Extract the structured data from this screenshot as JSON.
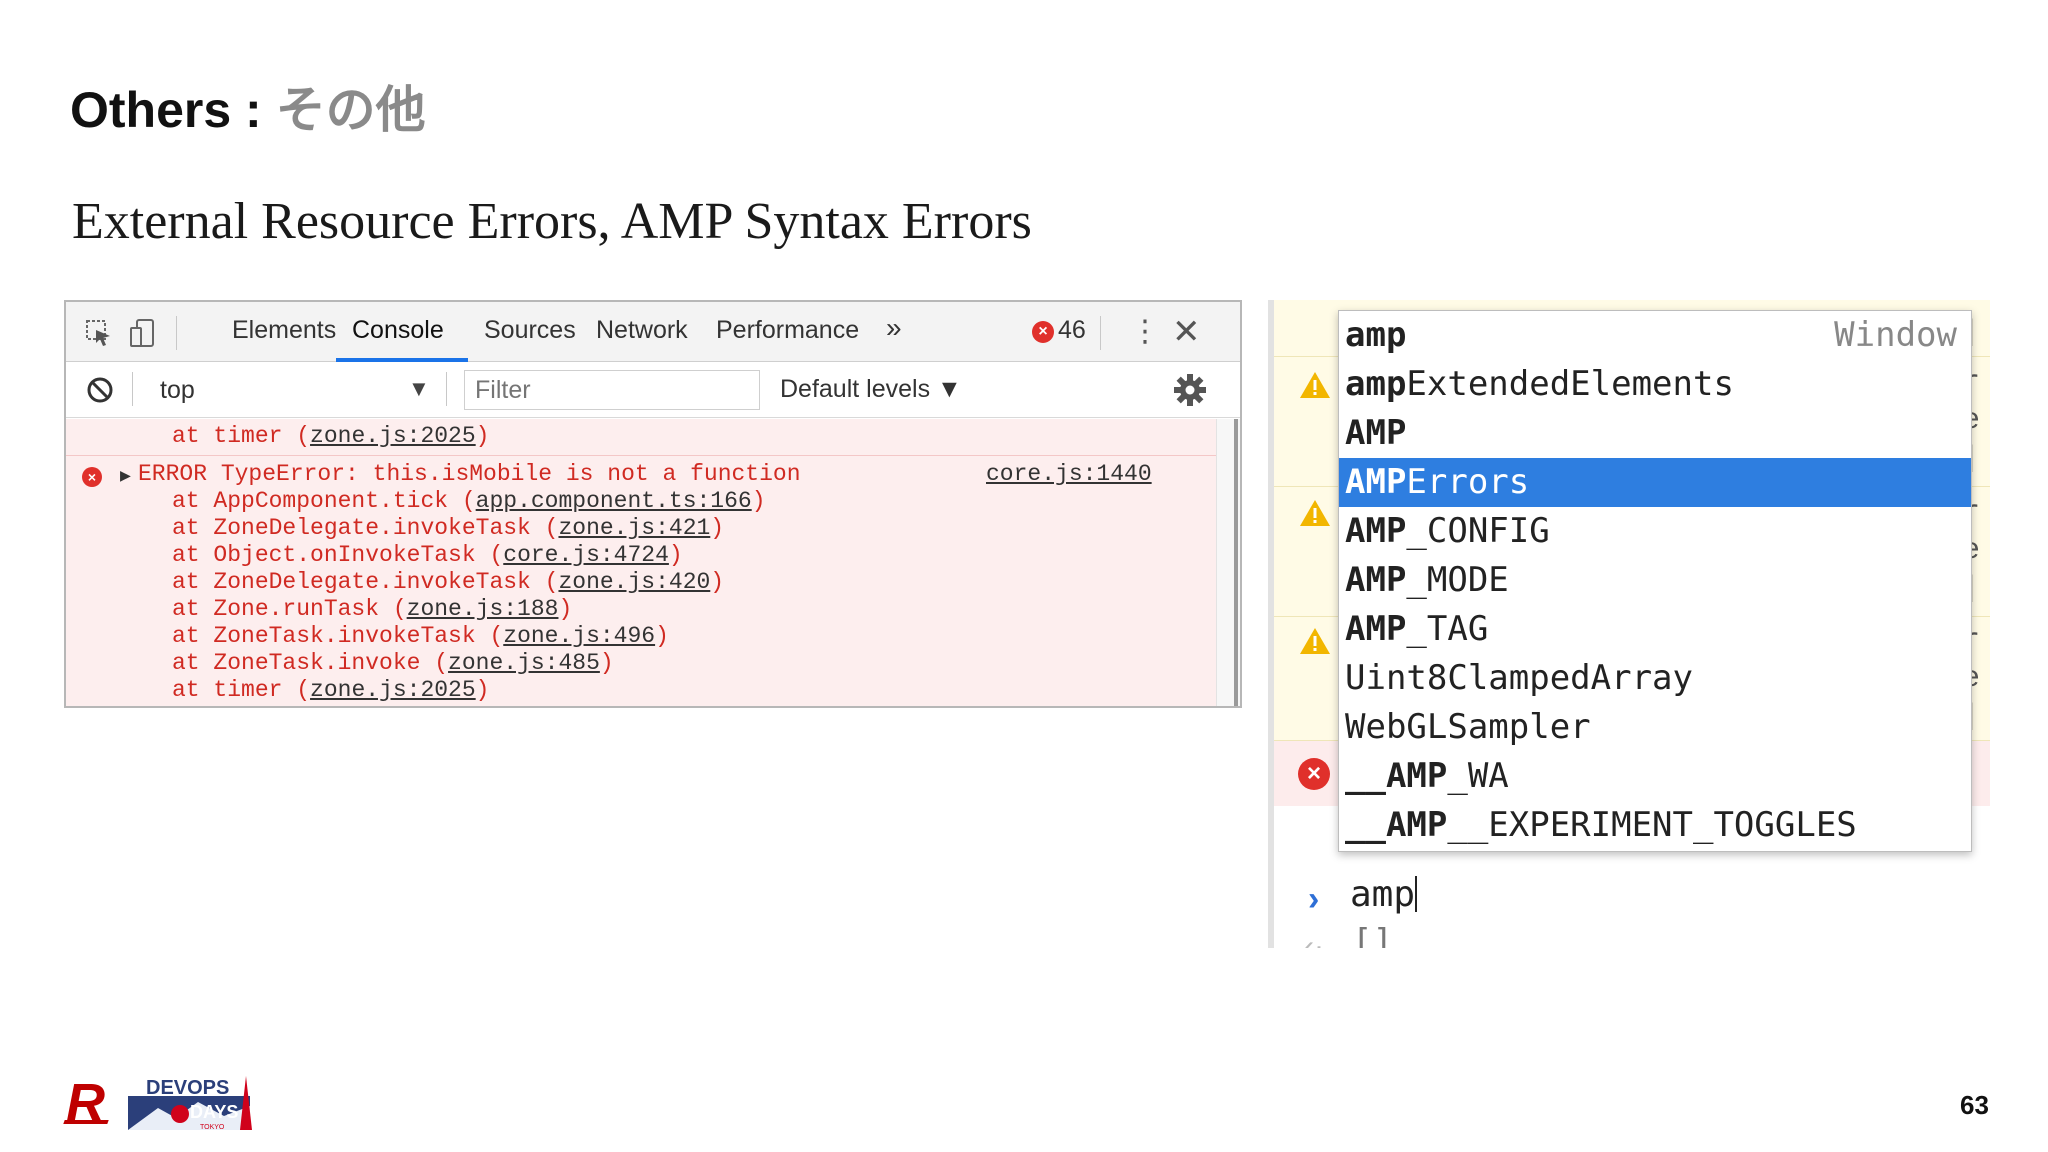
{
  "slide": {
    "title_prefix": "Others : ",
    "title_jp": "その他",
    "subtitle": "External Resource Errors, AMP Syntax Errors",
    "page_number": "63"
  },
  "devtools": {
    "tabs": [
      "Elements",
      "Console",
      "Sources",
      "Network",
      "Performance"
    ],
    "active_tab": "Console",
    "more_tabs": "»",
    "error_count": "46",
    "context": "top",
    "filter_placeholder": "Filter",
    "levels": "Default levels ▼",
    "console_lines": {
      "first_at": "at timer (",
      "first_link": "zone.js:2025",
      "error_text": "ERROR TypeError: this.isMobile is not a function",
      "error_source": "core.js:1440",
      "stack": [
        {
          "pre": "at AppComponent.tick (",
          "link": "app.component.ts:166"
        },
        {
          "pre": "at ZoneDelegate.invokeTask (",
          "link": "zone.js:421"
        },
        {
          "pre": "at Object.onInvokeTask (",
          "link": "core.js:4724"
        },
        {
          "pre": "at ZoneDelegate.invokeTask (",
          "link": "zone.js:420"
        },
        {
          "pre": "at Zone.runTask (",
          "link": "zone.js:188"
        },
        {
          "pre": "at ZoneTask.invokeTask (",
          "link": "zone.js:496"
        },
        {
          "pre": "at ZoneTask.invoke (",
          "link": "zone.js:485"
        },
        {
          "pre": "at timer (",
          "link": "zone.js:2025"
        }
      ]
    }
  },
  "autocomplete": {
    "items": [
      {
        "match": "amp",
        "rest": ""
      },
      {
        "match": "amp",
        "rest": "ExtendedElements"
      },
      {
        "match": "AMP",
        "rest": ""
      },
      {
        "match": "AMP",
        "rest": "Errors"
      },
      {
        "match": "AMP",
        "rest": "_CONFIG"
      },
      {
        "match": "AMP",
        "rest": "_MODE"
      },
      {
        "match": "AMP",
        "rest": "_TAG"
      },
      {
        "match": "Uint8Cl",
        "rest": "ampedArray"
      },
      {
        "match": "WebGLS",
        "rest": "ampler"
      },
      {
        "match": "__AMP",
        "rest": "_WA"
      },
      {
        "match": "__AMP",
        "rest": "__EXPERIMENT_TOGGLES"
      }
    ],
    "selected_index": 3,
    "hint": "Window",
    "prompt_input": "amp",
    "result": "[]"
  },
  "footer": {
    "rakuten_logo": "R",
    "devops_logo_line1": "DEVOPS",
    "devops_logo_line2": "DAYS",
    "devops_logo_line3": "TOKYO"
  },
  "colors": {
    "accent_blue": "#1a73e8",
    "error_red": "#d02a22",
    "selection_blue": "#2e7ee0",
    "rakuten_red": "#bf0000"
  }
}
